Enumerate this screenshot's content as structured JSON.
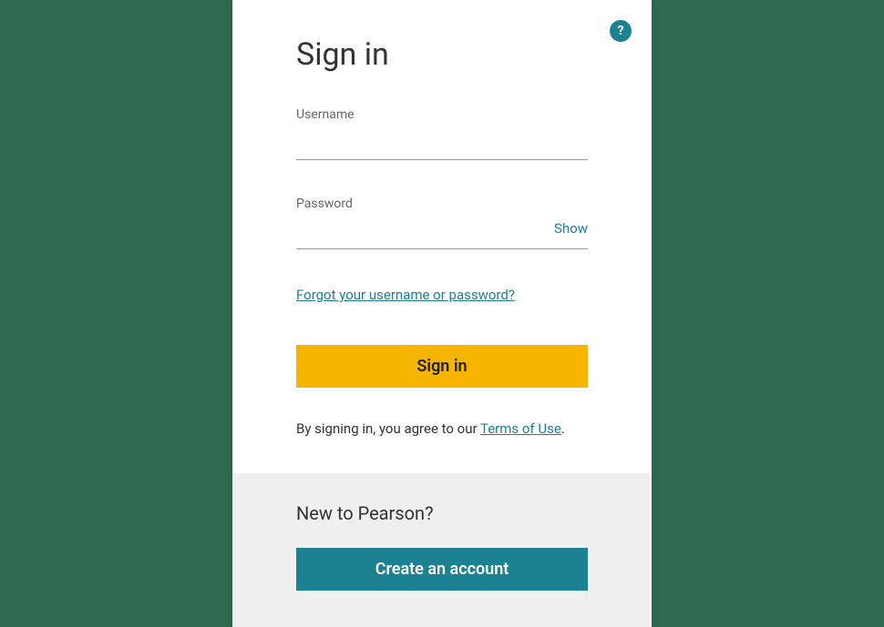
{
  "help_icon": "?",
  "title": "Sign in",
  "username": {
    "label": "Username",
    "value": ""
  },
  "password": {
    "label": "Password",
    "value": "",
    "show_label": "Show"
  },
  "forgot_link": "Forgot your username or password?",
  "sign_in_button": "Sign in",
  "terms": {
    "prefix": "By signing in, you agree to our ",
    "link": "Terms of Use",
    "suffix": "."
  },
  "footer": {
    "heading": "New to Pearson?",
    "create_button": "Create an account"
  }
}
